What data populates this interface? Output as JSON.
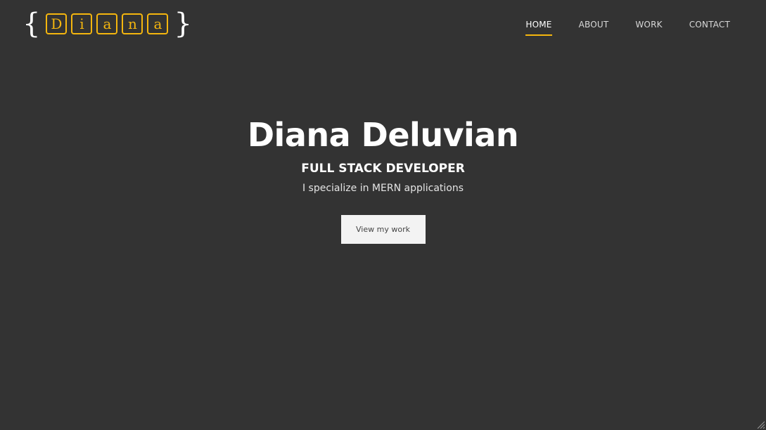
{
  "logo": {
    "open_brace": "{",
    "letters": [
      "D",
      "i",
      "a",
      "n",
      "a"
    ],
    "close_brace": "}"
  },
  "nav": {
    "items": [
      {
        "label": "HOME",
        "active": true
      },
      {
        "label": "ABOUT",
        "active": false
      },
      {
        "label": "WORK",
        "active": false
      },
      {
        "label": "CONTACT",
        "active": false
      }
    ]
  },
  "hero": {
    "name": "Diana Deluvian",
    "title": "FULL STACK DEVELOPER",
    "subtitle": "I specialize in MERN applications",
    "cta_label": "View my work"
  },
  "colors": {
    "background": "#333333",
    "accent": "#f5b60e",
    "text": "#ffffff",
    "button_bg": "#f3f3f3"
  }
}
